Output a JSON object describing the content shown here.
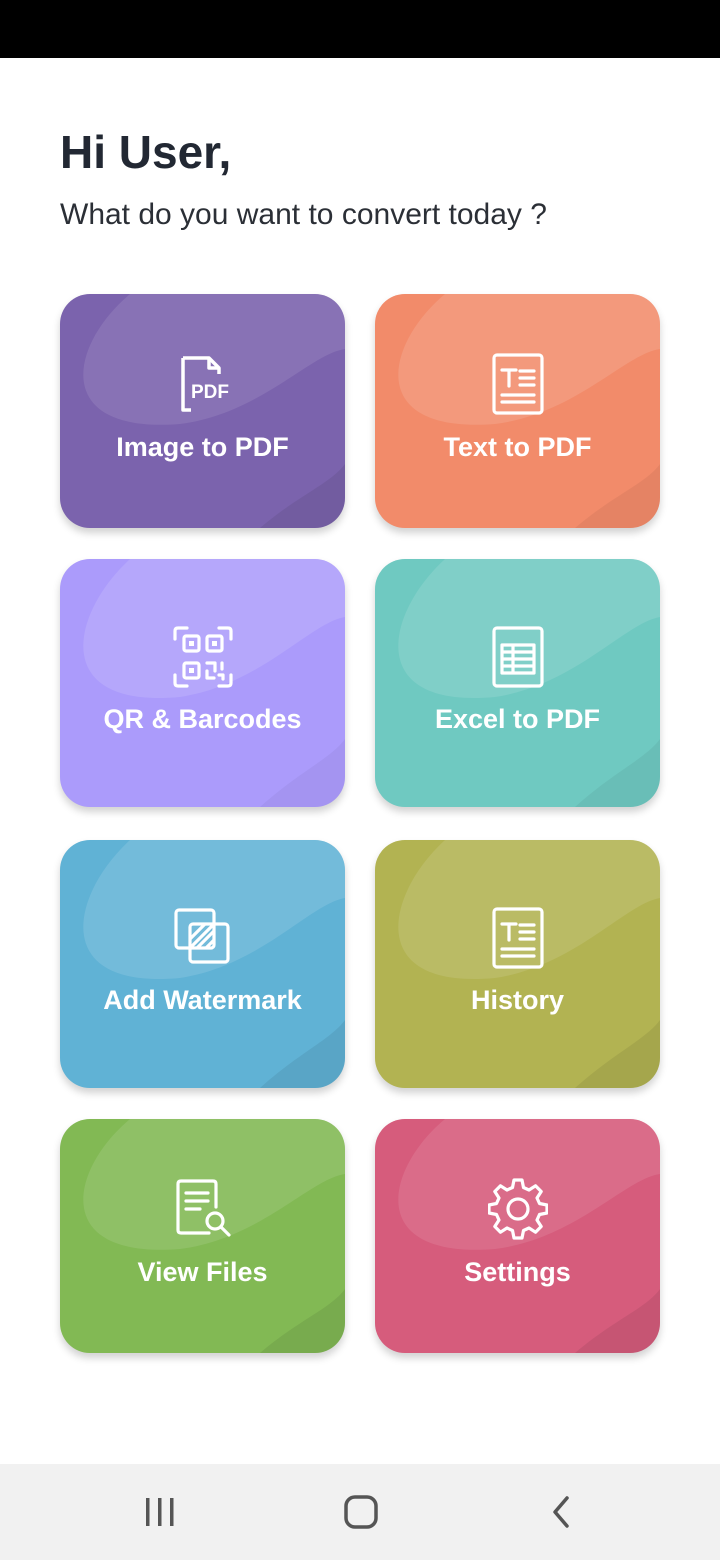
{
  "header": {
    "greeting": "Hi User,",
    "subtitle": "What do you want to convert today ?"
  },
  "tiles": [
    {
      "label": "Image to PDF",
      "icon": "pdf-file-icon",
      "color": "#7b63ad"
    },
    {
      "label": "Text to PDF",
      "icon": "text-document-icon",
      "color": "#f28b6a"
    },
    {
      "label": "QR & Barcodes",
      "icon": "qr-code-icon",
      "color": "#ab9bfb"
    },
    {
      "label": "Excel to PDF",
      "icon": "spreadsheet-icon",
      "color": "#6fc9c1"
    },
    {
      "label": "Add Watermark",
      "icon": "watermark-icon",
      "color": "#60b2d5"
    },
    {
      "label": "History",
      "icon": "history-document-icon",
      "color": "#b2b352"
    },
    {
      "label": "View Files",
      "icon": "file-search-icon",
      "color": "#82b954"
    },
    {
      "label": "Settings",
      "icon": "gear-icon",
      "color": "#d65c7c"
    }
  ],
  "navigation": {
    "buttons": [
      "recent-apps-icon",
      "home-icon",
      "back-icon"
    ]
  }
}
